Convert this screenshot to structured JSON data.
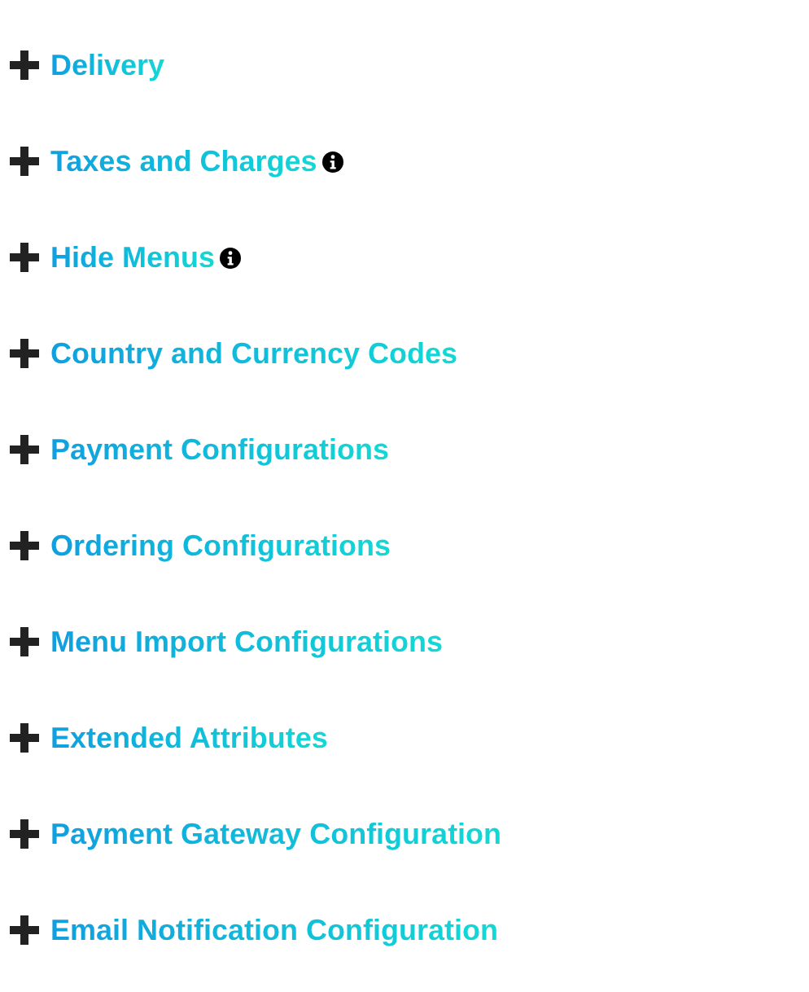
{
  "sections": [
    {
      "title": "Delivery",
      "expanded": false,
      "info": false
    },
    {
      "title": "Taxes and Charges",
      "expanded": false,
      "info": true
    },
    {
      "title": "Hide Menus",
      "expanded": false,
      "info": true
    },
    {
      "title": "Country and Currency Codes",
      "expanded": false,
      "info": false
    },
    {
      "title": "Payment Configurations",
      "expanded": false,
      "info": false
    },
    {
      "title": "Ordering Configurations",
      "expanded": false,
      "info": false
    },
    {
      "title": "Menu Import Configurations",
      "expanded": false,
      "info": false
    },
    {
      "title": "Extended Attributes",
      "expanded": false,
      "info": false
    },
    {
      "title": "Payment Gateway Configuration",
      "expanded": false,
      "info": false
    },
    {
      "title": "Email Notification Configuration",
      "expanded": false,
      "info": false
    }
  ]
}
